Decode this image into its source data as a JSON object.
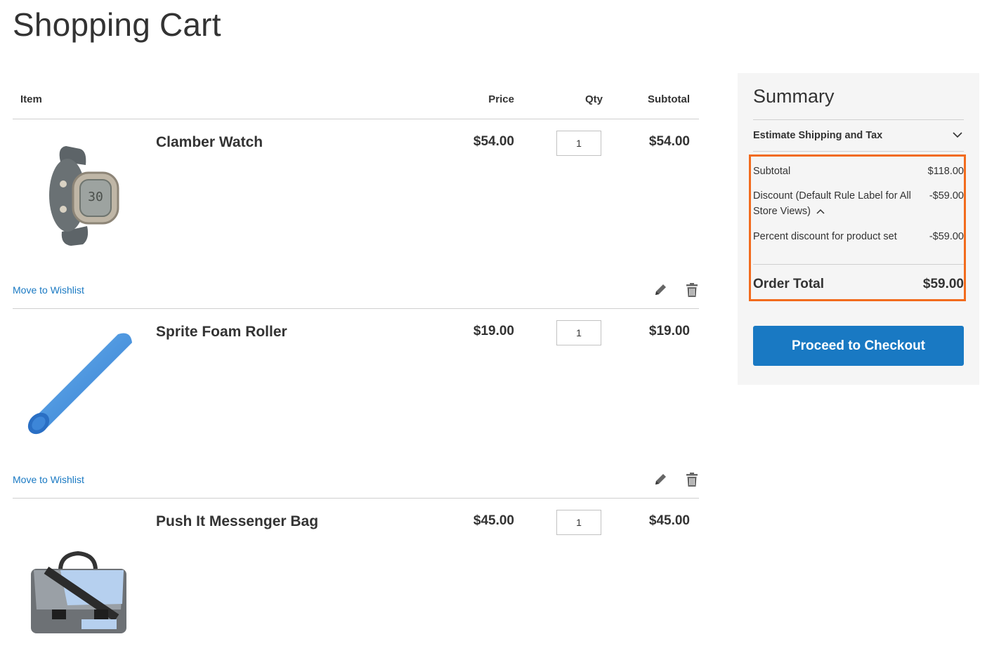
{
  "page": {
    "title": "Shopping Cart"
  },
  "cart": {
    "headers": {
      "item": "Item",
      "price": "Price",
      "qty": "Qty",
      "subtotal": "Subtotal"
    },
    "items": [
      {
        "name": "Clamber Watch",
        "price": "$54.00",
        "qty": "1",
        "subtotal": "$54.00",
        "image_icon": "watch-image",
        "wishlist_label": "Move to Wishlist"
      },
      {
        "name": "Sprite Foam Roller",
        "price": "$19.00",
        "qty": "1",
        "subtotal": "$19.00",
        "image_icon": "foam-roller-image",
        "wishlist_label": "Move to Wishlist"
      },
      {
        "name": "Push It Messenger Bag",
        "price": "$45.00",
        "qty": "1",
        "subtotal": "$45.00",
        "image_icon": "messenger-bag-image"
      }
    ]
  },
  "summary": {
    "title": "Summary",
    "shipping_label": "Estimate Shipping and Tax",
    "subtotal_label": "Subtotal",
    "subtotal_value": "$118.00",
    "discount_label": "Discount (Default Rule Label for All Store Views)",
    "discount_value": "-$59.00",
    "percent_label": "Percent discount for product set",
    "percent_value": "-$59.00",
    "total_label": "Order Total",
    "total_value": "$59.00",
    "checkout_label": "Proceed to Checkout"
  },
  "colors": {
    "accent_blue": "#1979c3",
    "highlight_orange": "#f26b1d",
    "summary_bg": "#f5f5f5"
  }
}
